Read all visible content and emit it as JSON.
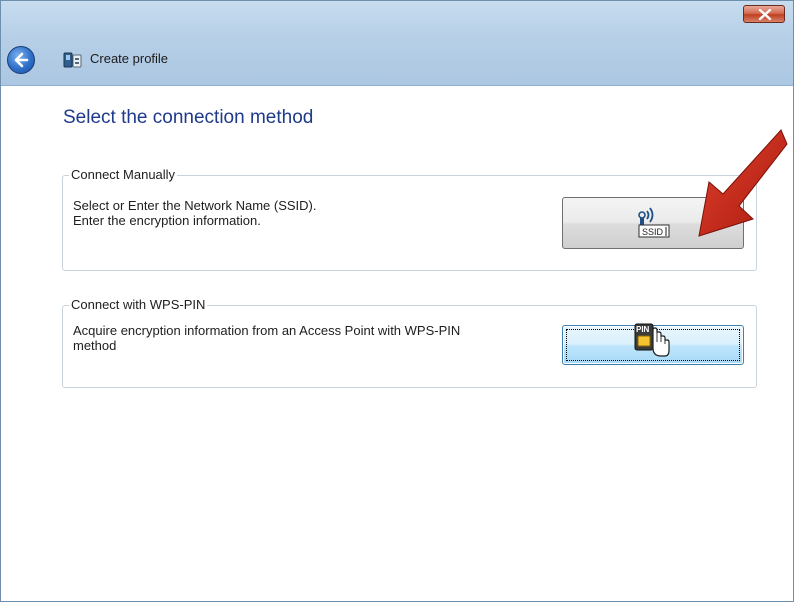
{
  "window": {
    "title": "Create profile"
  },
  "page": {
    "heading": "Select the connection method"
  },
  "groups": [
    {
      "legend": "Connect Manually",
      "line1": "Select or Enter the Network Name (SSID).",
      "line2": "Enter the encryption information.",
      "button_icon": "ssid-wireless-icon",
      "button_icon_text": "SSID"
    },
    {
      "legend": "Connect with WPS-PIN",
      "line1": "Acquire encryption information from an Access Point with WPS-PIN",
      "line2": "method",
      "button_icon": "wps-pin-hand-icon",
      "button_icon_text": "PIN"
    }
  ],
  "colors": {
    "heading": "#1e3a8a",
    "titlebar": "#b6cfe7",
    "close": "#c0401f",
    "annotation_arrow": "#d02a1a"
  }
}
